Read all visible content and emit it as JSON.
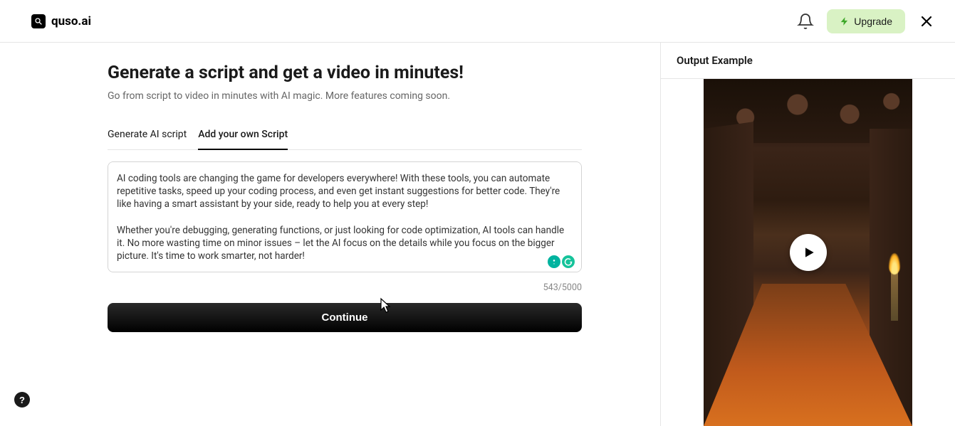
{
  "header": {
    "logo_text": "quso.ai",
    "upgrade_label": "Upgrade"
  },
  "main": {
    "title": "Generate a script and get a video in minutes!",
    "subtitle": "Go from script to video in minutes with AI magic. More features coming soon.",
    "tabs": [
      {
        "label": "Generate AI script"
      },
      {
        "label": "Add your own Script"
      }
    ],
    "script_text": "AI coding tools are changing the game for developers everywhere! With these tools, you can automate repetitive tasks, speed up your coding process, and even get instant suggestions for better code. They're like having a smart assistant by your side, ready to help you at every step!\n\nWhether you're debugging, generating functions, or just looking for code optimization, AI tools can handle it. No more wasting time on minor issues – let the AI focus on the details while you focus on the bigger picture. It's time to work smarter, not harder!",
    "char_count": "543/5000",
    "continue_label": "Continue"
  },
  "side": {
    "heading": "Output Example"
  },
  "help_label": "?"
}
